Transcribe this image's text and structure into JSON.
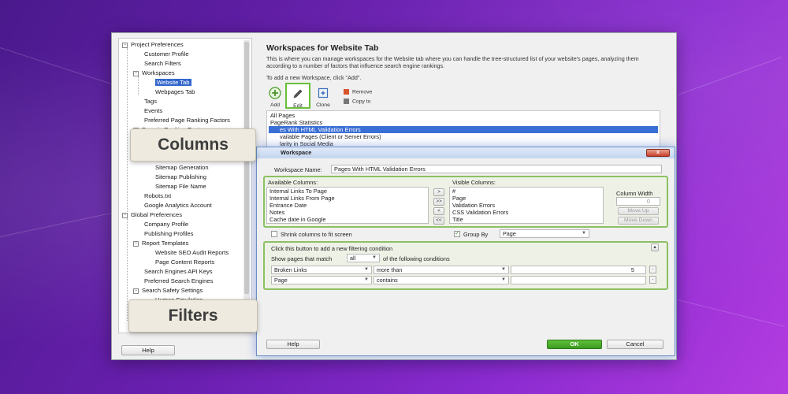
{
  "colors": {
    "accent": "#3366cc",
    "ok": "#46a62a",
    "highlight": "#8cc063",
    "background": "#6a1fb0"
  },
  "sidebar": {
    "items": [
      {
        "label": "Project Preferences",
        "expander": "−"
      },
      {
        "label": "Customer Profile"
      },
      {
        "label": "Search Filters"
      },
      {
        "label": "Workspaces",
        "expander": "−"
      },
      {
        "label": "Website Tab",
        "selected": true
      },
      {
        "label": "Webpages Tab"
      },
      {
        "label": "Tags"
      },
      {
        "label": "Events"
      },
      {
        "label": "Preferred Page Ranking Factors"
      },
      {
        "label": "Domain Ranking Factors",
        "expander": "−"
      },
      {
        "label": "Sitemap Generation"
      },
      {
        "label": "Sitemap Publishing"
      },
      {
        "label": "Sitemap File Name"
      },
      {
        "label": "Robots.txt"
      },
      {
        "label": "Google Analytics Account"
      },
      {
        "label": "Global Preferences",
        "expander": "−"
      },
      {
        "label": "Company Profile"
      },
      {
        "label": "Publishing Profiles"
      },
      {
        "label": "Report Templates",
        "expander": "−"
      },
      {
        "label": "Website SEO Audit Reports"
      },
      {
        "label": "Page Content Reports"
      },
      {
        "label": "Search Engines API Keys"
      },
      {
        "label": "Preferred Search Engines"
      },
      {
        "label": "Search Safety Settings",
        "expander": "−"
      },
      {
        "label": "Human Emulation"
      }
    ],
    "help_label": "Help"
  },
  "main": {
    "title": "Workspaces for Website Tab",
    "description": "This is where you can manage workspaces for the Website tab where you can handle the tree-structured list of your website's pages, analyzing them according to a number of factors that influence search engine rankings.",
    "hint": "To add a new Workspace, click \"Add\".",
    "toolbar": {
      "add": "Add",
      "edit": "Edit",
      "clone": "Clone",
      "remove": "Remove",
      "copy_to": "Copy to"
    },
    "workspaces": [
      {
        "label": "All Pages"
      },
      {
        "label": "PageRank Statistics"
      },
      {
        "label": "es With HTML Validation Errors",
        "selected": true
      },
      {
        "label": "vailable Pages (Client or Server Errors)"
      },
      {
        "label": "larity in Social Media"
      }
    ]
  },
  "dialog": {
    "title": "Workspace",
    "close_label": "x",
    "name_label": "Workspace Name:",
    "name_value": "Pages With HTML Validation Errors",
    "available_label": "Available Columns:",
    "available": [
      "Internal Links To Page",
      "Internal Links From Page",
      "Entrance Date",
      "Notes",
      "Cache date in Google"
    ],
    "visible_label": "Visible Columns:",
    "visible": [
      "#",
      "Page",
      "Validation  Errors",
      "CSS Validation Errors",
      "Title"
    ],
    "column_width_label": "Column Width",
    "column_width_value": "0",
    "move_up": "Move Up",
    "move_down": "Move Down",
    "shrink_label": "Shrink columns to fit screen",
    "group_by_label": "Group By",
    "group_by_value": "Page",
    "filter_hint": "Click this button to add a new filtering condition",
    "match_prefix": "Show pages that match",
    "match_value": "all",
    "match_suffix": "of the following conditions",
    "filters": [
      {
        "field": "Broken Links",
        "op": "more than",
        "value": "5"
      },
      {
        "field": "Page",
        "op": "contains",
        "value": ""
      }
    ],
    "help": "Help",
    "ok": "OK",
    "cancel": "Cancel"
  },
  "callouts": {
    "columns": "Columns",
    "filters": "Filters"
  }
}
